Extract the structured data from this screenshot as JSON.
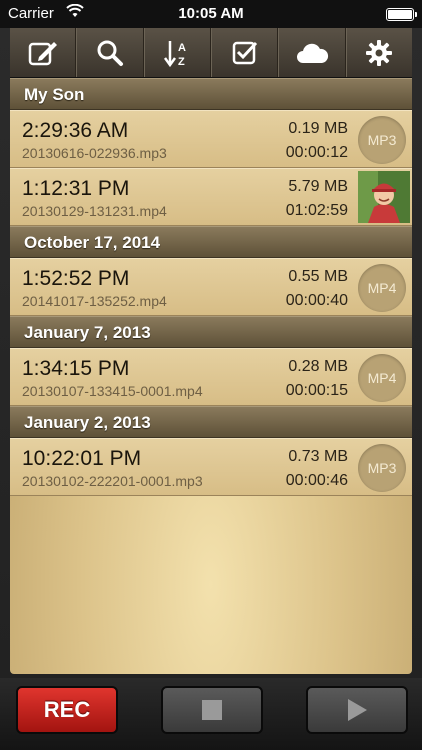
{
  "status_bar": {
    "carrier": "Carrier",
    "time": "10:05 AM"
  },
  "toolbar": {
    "items": [
      {
        "icon": "edit-icon"
      },
      {
        "icon": "search-icon"
      },
      {
        "icon": "sort-az-icon"
      },
      {
        "icon": "select-checkbox-icon"
      },
      {
        "icon": "cloud-icon"
      },
      {
        "icon": "gear-icon"
      }
    ]
  },
  "sections": [
    {
      "title": "My Son",
      "rows": [
        {
          "time": "2:29:36 AM",
          "file": "20130616-022936.mp3",
          "size": "0.19 MB",
          "duration": "00:00:12",
          "badge": "MP3"
        },
        {
          "time": "1:12:31 PM",
          "file": "20130129-131231.mp4",
          "size": "5.79 MB",
          "duration": "01:02:59",
          "thumbnail": "child-photo"
        }
      ]
    },
    {
      "title": "October 17, 2014",
      "rows": [
        {
          "time": "1:52:52 PM",
          "file": "20141017-135252.mp4",
          "size": "0.55 MB",
          "duration": "00:00:40",
          "badge": "MP4"
        }
      ]
    },
    {
      "title": "January 7, 2013",
      "rows": [
        {
          "time": "1:34:15 PM",
          "file": "20130107-133415-0001.mp4",
          "size": "0.28 MB",
          "duration": "00:00:15",
          "badge": "MP4"
        }
      ]
    },
    {
      "title": "January 2, 2013",
      "rows": [
        {
          "time": "10:22:01 PM",
          "file": "20130102-222201-0001.mp3",
          "size": "0.73 MB",
          "duration": "00:00:46",
          "badge": "MP3"
        }
      ]
    }
  ],
  "controls": {
    "rec_label": "REC"
  },
  "colors": {
    "rec": "#c8211b",
    "section_header": "#6e6146",
    "row": "#dcc48e"
  }
}
